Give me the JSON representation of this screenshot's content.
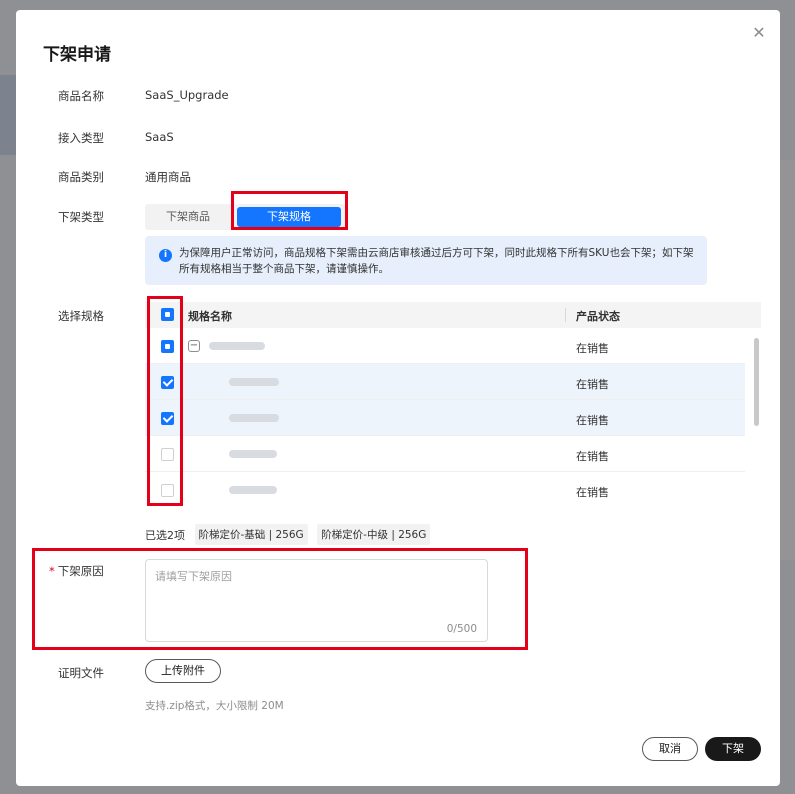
{
  "dialog": {
    "title": "下架申请",
    "close_icon": "close-icon"
  },
  "fields": {
    "product_name_label": "商品名称",
    "product_name_value": "SaaS_Upgrade",
    "access_type_label": "接入类型",
    "access_type_value": "SaaS",
    "category_label": "商品类别",
    "category_value": "通用商品",
    "delist_type_label": "下架类型",
    "delist_type_options": [
      "下架商品",
      "下架规格"
    ],
    "delist_type_selected": "下架规格",
    "select_spec_label": "选择规格",
    "reason_label": "下架原因",
    "proof_label": "证明文件"
  },
  "info": {
    "icon": "info-icon",
    "text": "为保障用户正常访问，商品规格下架需由云商店审核通过后方可下架，同时此规格下所有SKU也会下架；如下架所有规格相当于整个商品下架，请谨慎操作。"
  },
  "table": {
    "columns": [
      "规格名称",
      "产品状态"
    ],
    "rows": [
      {
        "state": "indeterminate",
        "status": "在销售"
      },
      {
        "state": "checked",
        "status": "在销售"
      },
      {
        "state": "checked",
        "status": "在销售"
      },
      {
        "state": "unchecked",
        "status": "在销售"
      },
      {
        "state": "unchecked",
        "status": "在销售"
      }
    ]
  },
  "selected": {
    "count_text": "已选2项",
    "tags": [
      "阶梯定价-基础 | 256G",
      "阶梯定价-中级 | 256G"
    ]
  },
  "reason": {
    "placeholder": "请填写下架原因",
    "counter": "0/500"
  },
  "upload": {
    "button_label": "上传附件",
    "hint": "支持.zip格式，大小限制 20M"
  },
  "footer": {
    "cancel_label": "取消",
    "submit_label": "下架"
  },
  "colors": {
    "primary": "#1476ff",
    "highlight_box": "#e5001a",
    "dark_button": "#191919"
  }
}
